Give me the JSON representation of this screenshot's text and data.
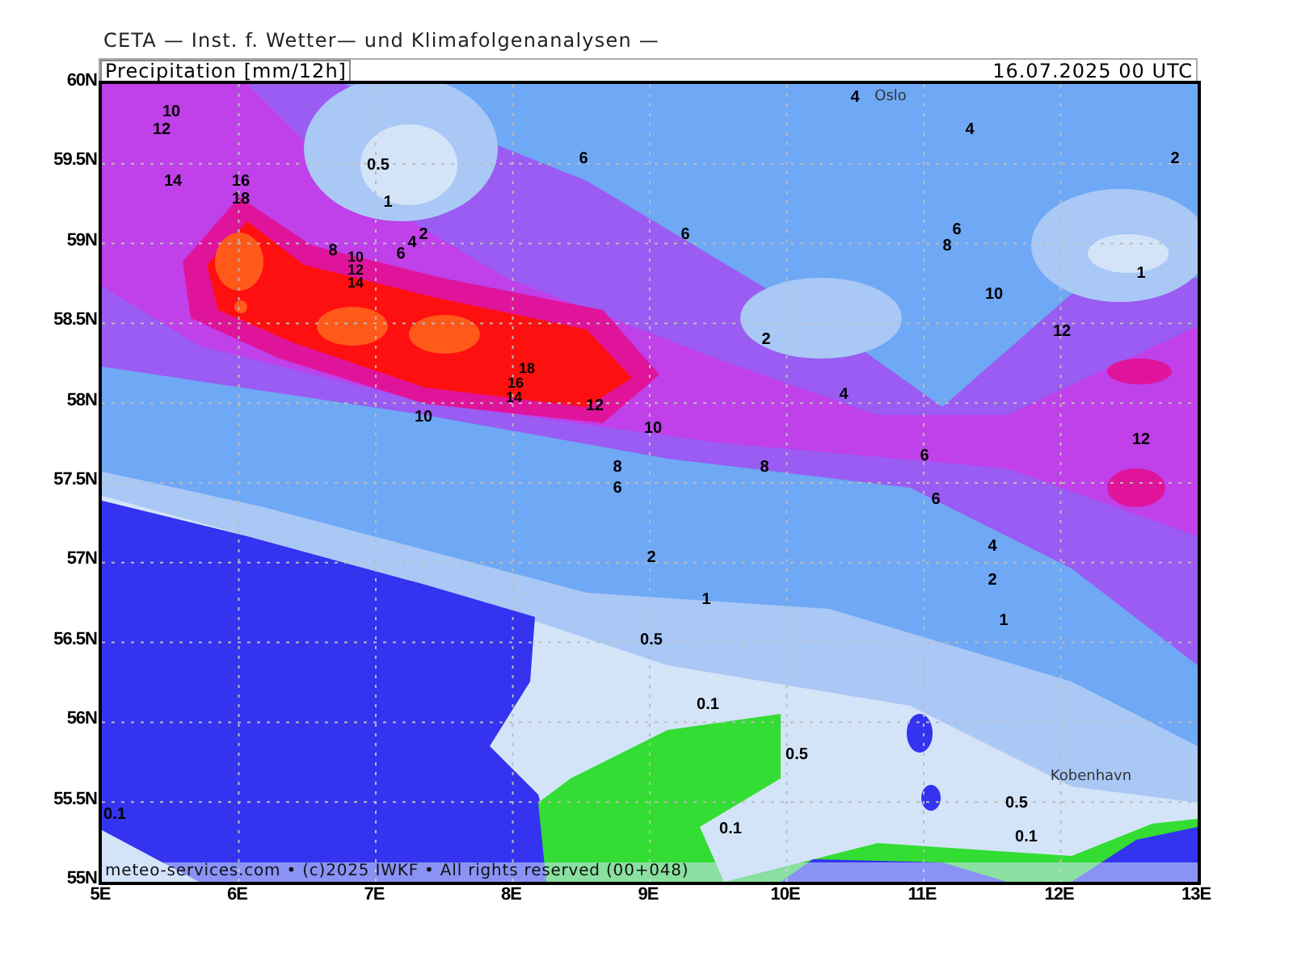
{
  "header": {
    "title": "CETA — Inst. f. Wetter— und Klimafolgenanalysen —"
  },
  "chart": {
    "variable": "Precipitation [mm/12h]",
    "valid_time": "16.07.2025 00 UTC",
    "lat_labels": [
      "60N",
      "59.5N",
      "59N",
      "58.5N",
      "58N",
      "57.5N",
      "57N",
      "56.5N",
      "56N",
      "55.5N",
      "55N"
    ],
    "lon_labels": [
      "5E",
      "6E",
      "7E",
      "8E",
      "9E",
      "10E",
      "11E",
      "12E",
      "13E"
    ],
    "place_labels": [
      "Oslo",
      "Kobenhavn"
    ],
    "contour_labels": [
      "10",
      "12",
      "14",
      "16",
      "18",
      "0.5",
      "1",
      "8",
      "10",
      "12",
      "14",
      "6",
      "4",
      "2",
      "6",
      "6",
      "4",
      "4",
      "2",
      "6",
      "8",
      "1",
      "10",
      "2",
      "12",
      "18",
      "16",
      "14",
      "4",
      "12",
      "10",
      "10",
      "12",
      "6",
      "8",
      "8",
      "6",
      "6",
      "4",
      "2",
      "2",
      "1",
      "1",
      "0.5",
      "0.1",
      "0.5",
      "0.5",
      "0.1",
      "0.1",
      "0.1"
    ],
    "credit": "meteo-services.com • (c)2025 IWKF • All rights reserved (00+048)"
  }
}
